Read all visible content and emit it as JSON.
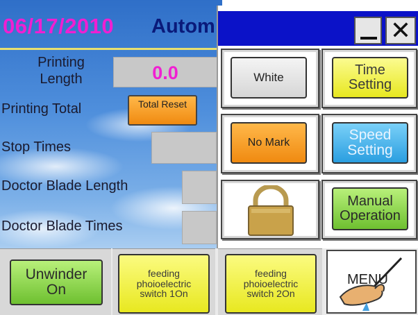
{
  "header": {
    "date": "06/17/2010",
    "mode": "Autom"
  },
  "fields": {
    "printing_length_label": "Printing Length",
    "printing_length_value": "0.0",
    "printing_total_label": "Printing Total",
    "total_reset_label": "Total Reset",
    "stop_times_label": "Stop Times",
    "doctor_blade_length_label": "Doctor Blade Length",
    "doctor_blade_times_label": "Doctor Blade Times"
  },
  "panel": {
    "buttons": {
      "white": "White",
      "time_setting": "Time Setting",
      "no_mark": "No Mark",
      "speed_setting": "Speed Setting",
      "manual_operation": "Manual Operation"
    }
  },
  "bottom": {
    "unwinder": "Unwinder On",
    "switch1": "feeding phoioelectric switch 1On",
    "switch2": "feeding phoioelectric switch 2On",
    "menu": "MENU"
  },
  "icons": [
    "lock-icon",
    "minimize-icon",
    "close-icon",
    "hand-pen-icon"
  ],
  "colors": {
    "date": "#f01fd2",
    "titlebar": "#0b12c8",
    "orange": "#f08a10",
    "yellow": "#e8e820",
    "green": "#6ec030",
    "blue": "#2a9ee0"
  }
}
